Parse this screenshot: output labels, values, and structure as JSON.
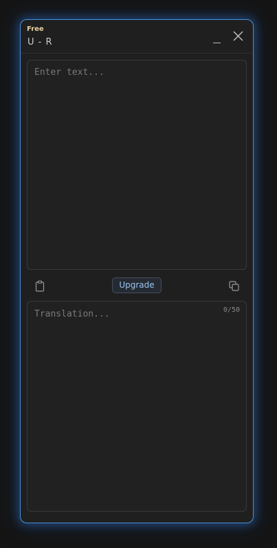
{
  "header": {
    "plan": "Free",
    "language_pair": "U - R"
  },
  "source": {
    "placeholder": "Enter text..."
  },
  "toolbar": {
    "upgrade_label": "Upgrade"
  },
  "translation": {
    "placeholder": "Translation...",
    "char_count": "0/50"
  },
  "icons": {
    "minimize": "minimize-icon",
    "close": "close-icon",
    "clipboard": "clipboard-icon",
    "copy": "copy-icon"
  },
  "colors": {
    "accent_border": "#4a8fd8",
    "badge": "#e6cfa0",
    "upgrade_text": "#9cc4f2",
    "background": "#1f1f1f"
  }
}
